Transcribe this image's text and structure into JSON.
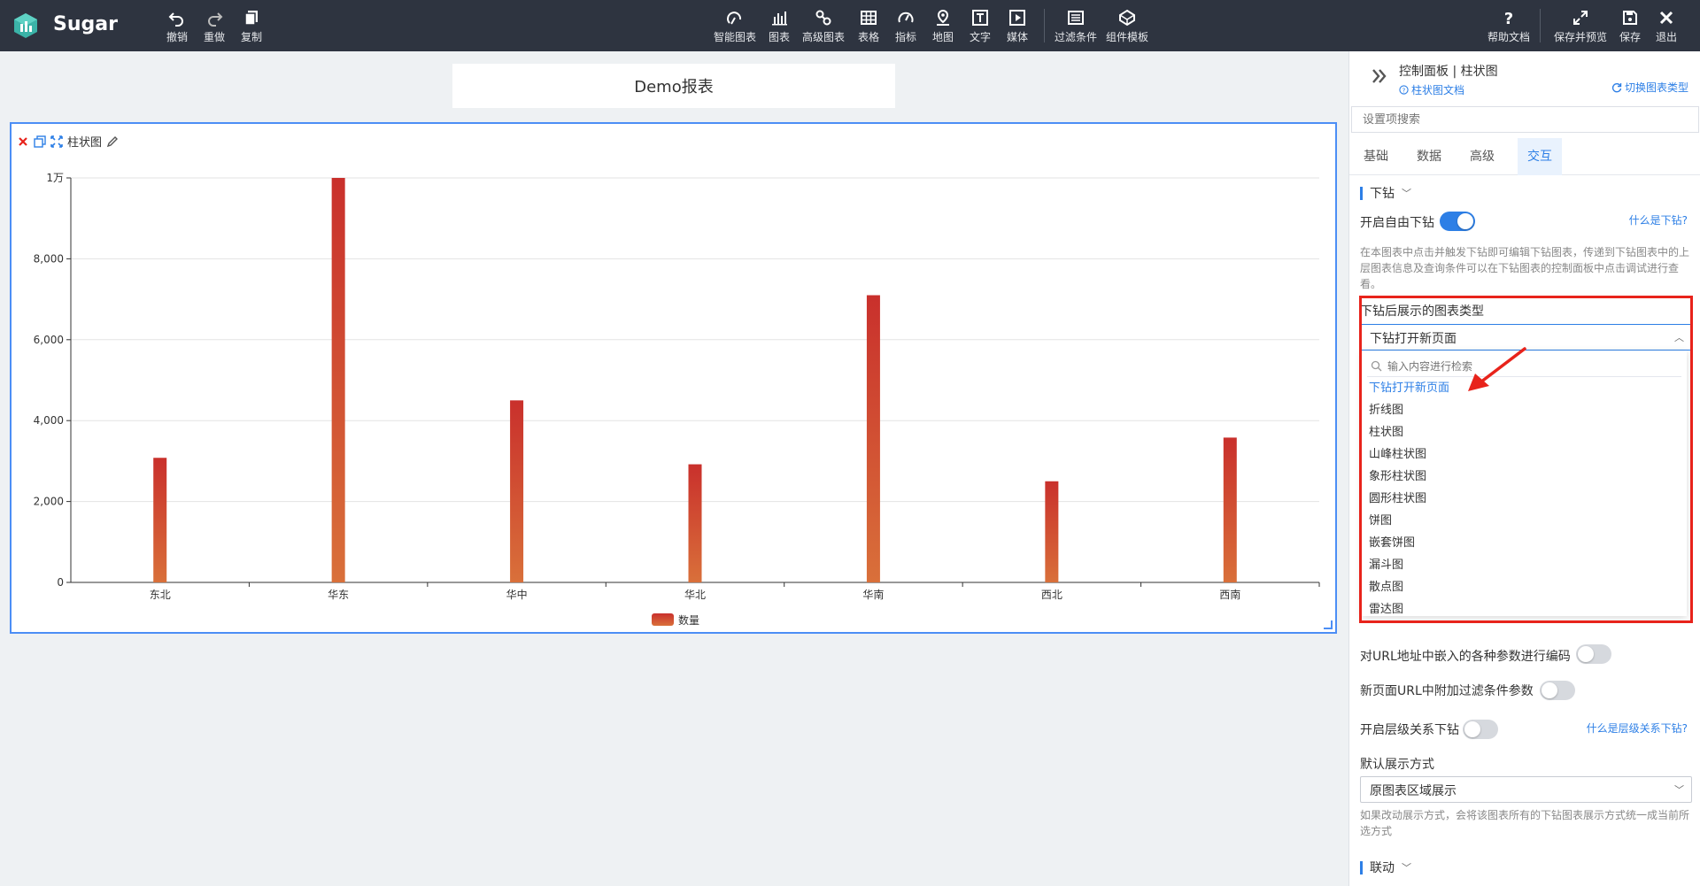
{
  "app": {
    "name": "Sugar"
  },
  "toolbar": {
    "left": [
      {
        "label": "撤销",
        "icon": "undo-icon"
      },
      {
        "label": "重做",
        "icon": "redo-icon"
      },
      {
        "label": "复制",
        "icon": "copy-icon"
      }
    ],
    "center": [
      {
        "label": "智能图表",
        "icon": "smart-chart-icon"
      },
      {
        "label": "图表",
        "icon": "bar-chart-icon"
      },
      {
        "label": "高级图表",
        "icon": "advanced-chart-icon"
      },
      {
        "label": "表格",
        "icon": "table-icon"
      },
      {
        "label": "指标",
        "icon": "gauge-icon"
      },
      {
        "label": "地图",
        "icon": "map-pin-icon"
      },
      {
        "label": "文字",
        "icon": "text-icon"
      },
      {
        "label": "媒体",
        "icon": "media-icon"
      },
      {
        "label": "过滤条件",
        "icon": "filter-icon"
      },
      {
        "label": "组件模板",
        "icon": "template-icon"
      }
    ],
    "right": [
      {
        "label": "帮助文档",
        "icon": "help-icon"
      },
      {
        "label": "保存并预览",
        "icon": "expand-icon"
      },
      {
        "label": "保存",
        "icon": "save-icon"
      },
      {
        "label": "退出",
        "icon": "close-icon"
      }
    ]
  },
  "report": {
    "title": "Demo报表"
  },
  "chart_card": {
    "label": "柱状图"
  },
  "chart_data": {
    "type": "bar",
    "categories": [
      "东北",
      "华东",
      "华中",
      "华北",
      "华南",
      "西北",
      "西南"
    ],
    "series": [
      {
        "name": "数量",
        "values": [
          3080,
          10000,
          4500,
          2920,
          7100,
          2500,
          3580
        ]
      }
    ],
    "ylim": [
      0,
      10000
    ],
    "yticks": [
      0,
      2000,
      4000,
      6000,
      8000,
      10000
    ],
    "ytick_labels": [
      "0",
      "2,000",
      "4,000",
      "6,000",
      "8,000",
      "1万"
    ],
    "grid": true,
    "legend": "bottom-center",
    "colors": {
      "top": "#c9302c",
      "bottom": "#d9703a"
    }
  },
  "panel": {
    "title": "控制面板 | 柱状图",
    "doc_link": "柱状图文档",
    "switch_link": "切换图表类型",
    "search_placeholder": "设置项搜索",
    "tabs": [
      "基础",
      "数据",
      "高级",
      "交互"
    ],
    "active_tab": "交互",
    "drill": {
      "section": "下钻",
      "free_drill_label": "开启自由下钻",
      "free_drill_on": true,
      "what_link": "什么是下钻?",
      "help": "在本图表中点击并触发下钻即可编辑下钻图表，传递到下钻图表中的上层图表信息及查询条件可以在下钻图表的控制面板中点击调试进行查看。",
      "type_label": "下钻后展示的图表类型",
      "type_value": "下钻打开新页面",
      "dropdown_search_placeholder": "输入内容进行检索",
      "options": [
        "下钻打开新页面",
        "折线图",
        "柱状图",
        "山峰柱状图",
        "象形柱状图",
        "圆形柱状图",
        "饼图",
        "嵌套饼图",
        "漏斗图",
        "散点图",
        "雷达图"
      ],
      "encode_label": "对URL地址中嵌入的各种参数进行编码",
      "filter_label": "新页面URL中附加过滤条件参数",
      "hier_label": "开启层级关系下钻",
      "hier_link": "什么是层级关系下钻?",
      "display_label": "默认展示方式",
      "display_value": "原图表区域展示",
      "display_help": "如果改动展示方式，会将该图表所有的下钻图表展示方式统一成当前所选方式"
    },
    "link_section": "联动"
  }
}
